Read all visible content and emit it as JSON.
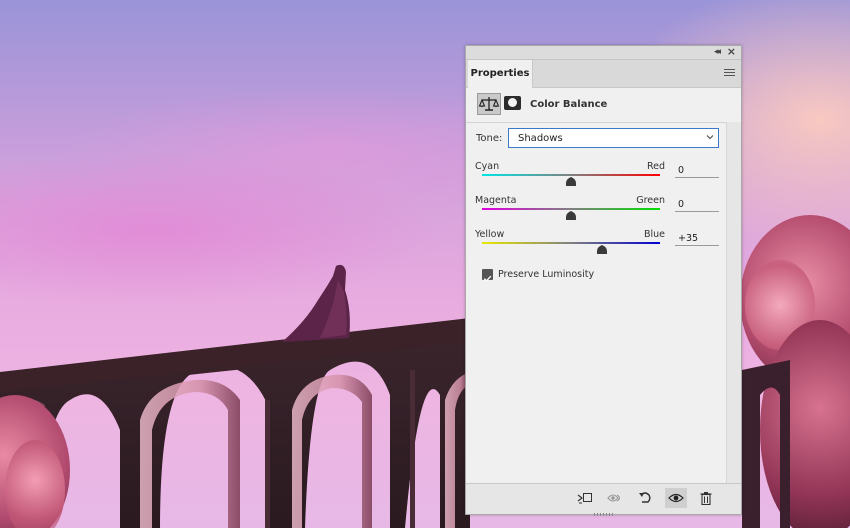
{
  "panel": {
    "tab_label": "Properties",
    "header_title": "Color Balance",
    "tone": {
      "label": "Tone:",
      "selected": "Shadows"
    },
    "sliders": [
      {
        "left": "Cyan",
        "right": "Red",
        "value": "0",
        "level": 0
      },
      {
        "left": "Magenta",
        "right": "Green",
        "value": "0",
        "level": 0
      },
      {
        "left": "Yellow",
        "right": "Blue",
        "value": "+35",
        "level": 35
      }
    ],
    "preserve_luminosity": {
      "label": "Preserve Luminosity",
      "checked": true
    },
    "footer_icons": [
      "clip-to-layer-icon",
      "view-previous-icon",
      "reset-icon",
      "visibility-eye-icon",
      "trash-icon"
    ]
  },
  "colors": {
    "panel_bg": "#f0f0f0",
    "select_border": "#3c78c8"
  }
}
